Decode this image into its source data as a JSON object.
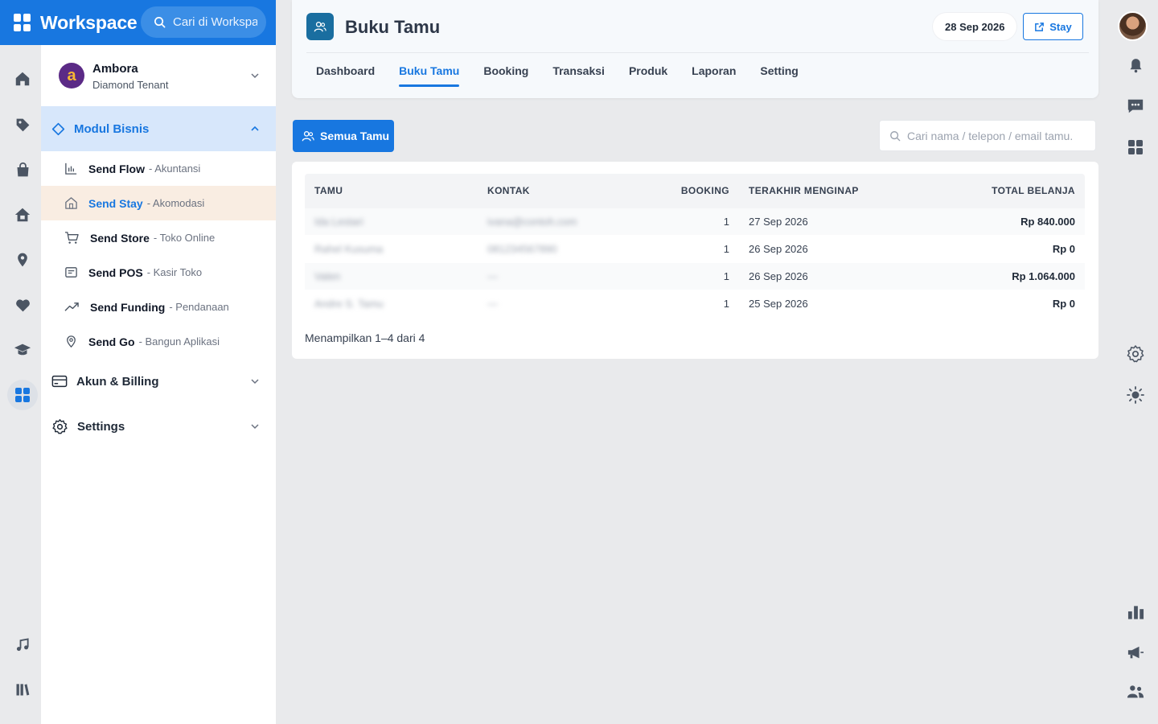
{
  "brand": {
    "title": "Workspace",
    "search_placeholder": "Cari di Workspace"
  },
  "tenant": {
    "name": "Ambora",
    "role": "Diamond Tenant",
    "avatar_letter": "a"
  },
  "sidebar": {
    "module_section": "Modul Bisnis",
    "modules": [
      {
        "name": "Send Flow",
        "sub": "- Akuntansi"
      },
      {
        "name": "Send Stay",
        "sub": "- Akomodasi"
      },
      {
        "name": "Send Store",
        "sub": "- Toko Online"
      },
      {
        "name": "Send POS",
        "sub": "- Kasir Toko"
      },
      {
        "name": "Send Funding",
        "sub": "- Pendanaan"
      },
      {
        "name": "Send Go",
        "sub": "- Bangun Aplikasi"
      }
    ],
    "account_section": "Akun & Billing",
    "settings_section": "Settings"
  },
  "header": {
    "title": "Buku Tamu",
    "date": "28 Sep 2026",
    "stay_button": "Stay",
    "tabs": [
      "Dashboard",
      "Buku Tamu",
      "Booking",
      "Transaksi",
      "Produk",
      "Laporan",
      "Setting"
    ]
  },
  "toolbar": {
    "all_guests_button": "Semua Tamu",
    "search_placeholder": "Cari nama / telepon / email tamu."
  },
  "table": {
    "columns": [
      "TAMU",
      "KONTAK",
      "BOOKING",
      "TERAKHIR MENGINAP",
      "TOTAL BELANJA"
    ],
    "rows": [
      {
        "guest": "Ida Lestari",
        "contact": "ivana@contoh.com",
        "booking": "1",
        "last_stay": "27 Sep 2026",
        "total": "Rp 840.000"
      },
      {
        "guest": "Rahel Kusuma",
        "contact": "081234567890",
        "booking": "1",
        "last_stay": "26 Sep 2026",
        "total": "Rp 0"
      },
      {
        "guest": "Valen",
        "contact": "—",
        "booking": "1",
        "last_stay": "26 Sep 2026",
        "total": "Rp 1.064.000"
      },
      {
        "guest": "Andre S. Tamu",
        "contact": "—",
        "booking": "1",
        "last_stay": "25 Sep 2026",
        "total": "Rp 0"
      }
    ],
    "summary": "Menampilkan 1–4 dari 4"
  },
  "colors": {
    "accent": "#1877e0",
    "module_active_bg": "#f9ede2",
    "section_open_bg": "#d7e7fb",
    "header_icon_bg": "#1a6ea0"
  }
}
